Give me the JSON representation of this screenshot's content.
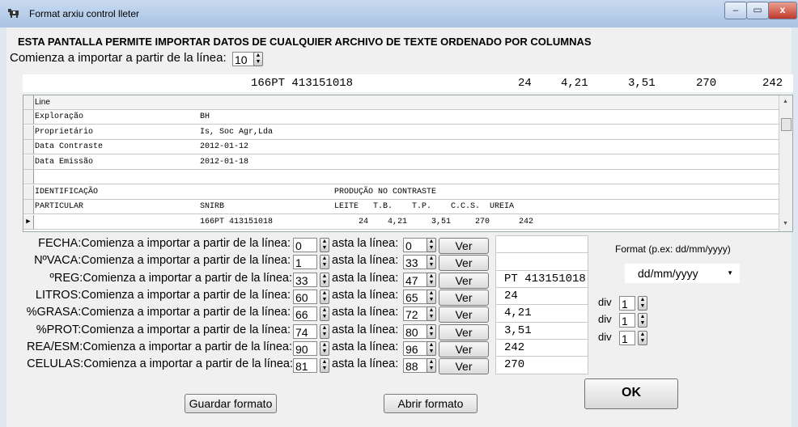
{
  "window": {
    "title": "Format arxiu control lleter",
    "min": "–",
    "max": "▭",
    "close": "x"
  },
  "heading": "ESTA PANTALLA PERMITE IMPORTAR DATOS DE CUALQUIER ARCHIVO DE TEXTE ORDENADO POR COLUMNAS",
  "start_label": "Comienza a importar a partir de la línea:",
  "start_value": "10",
  "preview": [
    "166PT 413151018",
    "24",
    "4,21",
    "3,51",
    "270",
    "242"
  ],
  "grid": {
    "header": "Line",
    "rows": [
      [
        "Exploração",
        "BH",
        ""
      ],
      [
        "Proprietário",
        "Is, Soc Agr,Lda",
        ""
      ],
      [
        "Data Contraste",
        "2012-01-12",
        ""
      ],
      [
        "Data Emissão",
        "2012-01-18",
        ""
      ],
      [
        "",
        "",
        ""
      ],
      [
        "IDENTIFICAÇÃO",
        "",
        "PRODUÇÃO NO CONTRASTE"
      ],
      [
        "PARTICULAR",
        "SNIRB",
        "LEITE   T.B.    T.P.    C.C.S.  UREIA"
      ],
      [
        "",
        "166PT 413151018",
        "     24    4,21     3,51     270      242"
      ]
    ],
    "current_row_marker": "▶"
  },
  "fields": [
    {
      "label": "FECHA:Comienza a importar a partir de la línea:",
      "from": "0",
      "to": "0",
      "ver": "Ver",
      "preview": ""
    },
    {
      "label": "NºVACA:Comienza a importar a partir de la línea:",
      "from": "1",
      "to": "33",
      "ver": "Ver",
      "preview": ""
    },
    {
      "label": "ºREG:Comienza a importar a partir de la línea:",
      "from": "33",
      "to": "47",
      "ver": "Ver",
      "preview": "PT 413151018"
    },
    {
      "label": "LITROS:Comienza a importar a partir de la línea:",
      "from": "60",
      "to": "65",
      "ver": "Ver",
      "preview": "24"
    },
    {
      "label": "%GRASA:Comienza a importar a partir de la línea:",
      "from": "66",
      "to": "72",
      "ver": "Ver",
      "preview": "4,21"
    },
    {
      "label": "%PROT:Comienza a importar a partir de la línea:",
      "from": "74",
      "to": "80",
      "ver": "Ver",
      "preview": "3,51"
    },
    {
      "label": "REA/ESM:Comienza a importar a partir de la línea:",
      "from": "90",
      "to": "96",
      "ver": "Ver",
      "preview": "242"
    },
    {
      "label": "CELULAS:Comienza a importar a partir de la línea:",
      "from": "81",
      "to": "88",
      "ver": "Ver",
      "preview": "270"
    }
  ],
  "to_label": "asta la línea:",
  "format": {
    "label": "Format (p.ex: dd/mm/yyyy)",
    "value": "dd/mm/yyyy"
  },
  "div": {
    "label": "div",
    "values": [
      "1",
      "1",
      "1"
    ]
  },
  "buttons": {
    "save": "Guardar formato",
    "open": "Abrir formato",
    "ok": "OK"
  }
}
